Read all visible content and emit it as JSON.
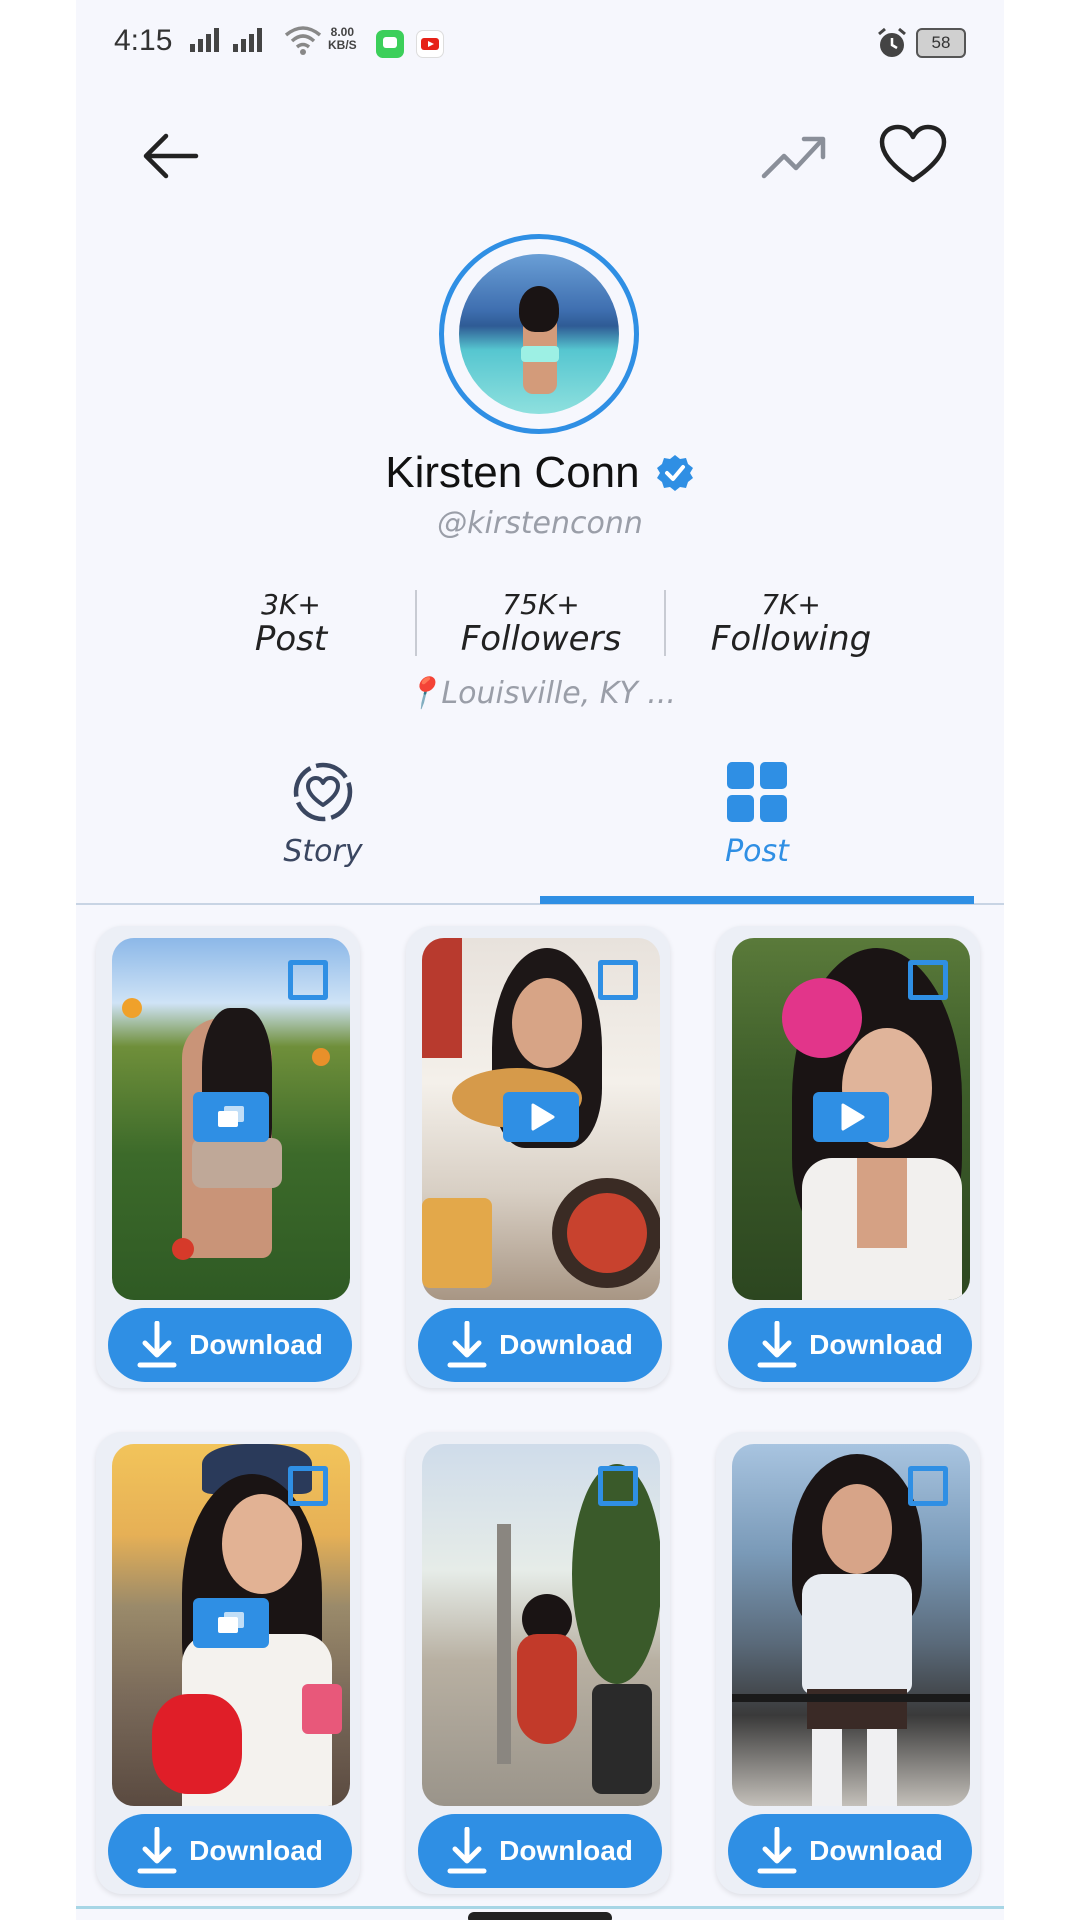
{
  "status_bar": {
    "time": "4:15",
    "net_speed_value": "8.00",
    "net_speed_unit": "KB/S",
    "battery": "58",
    "icons": [
      "signal-icon",
      "wifi-icon",
      "messages-app-icon",
      "youtube-app-icon",
      "alarm-icon",
      "battery-icon"
    ]
  },
  "header": {
    "icons": [
      "back-arrow-icon",
      "trending-icon",
      "heart-icon"
    ]
  },
  "profile": {
    "name": "Kirsten Conn",
    "handle": "@kirstenconn",
    "location": "📍Louisville, KY ...",
    "accent_color": "#2f8fe4"
  },
  "stats": [
    {
      "value": "3K+",
      "label": "Post"
    },
    {
      "value": "75K+",
      "label": "Followers"
    },
    {
      "value": "7K+",
      "label": "Following"
    }
  ],
  "tabs": [
    {
      "label": "Story",
      "active": false,
      "icon": "heart-circle-icon"
    },
    {
      "label": "Post",
      "active": true,
      "icon": "grid-icon"
    }
  ],
  "posts": [
    {
      "media": "gallery",
      "download_label": "Download"
    },
    {
      "media": "video",
      "download_label": "Download"
    },
    {
      "media": "video",
      "download_label": "Download"
    },
    {
      "media": "gallery",
      "download_label": "Download"
    },
    {
      "media": "none",
      "download_label": "Download"
    },
    {
      "media": "none",
      "download_label": "Download"
    }
  ]
}
